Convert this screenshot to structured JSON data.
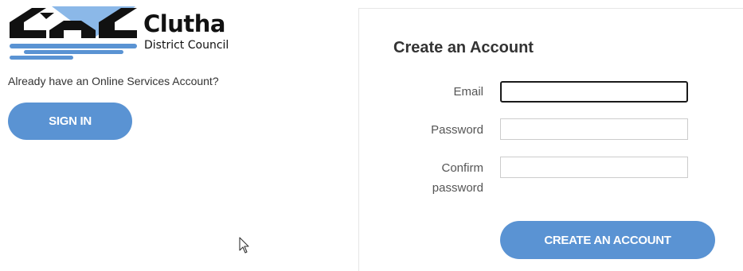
{
  "brand": {
    "name": "Clutha",
    "subtitle": "District Council",
    "colors": {
      "dark": "#111111",
      "accent": "#5a93d3",
      "light_blue": "#8bb8e8"
    }
  },
  "signin_section": {
    "prompt": "Already have an Online Services Account?",
    "button_label": "SIGN IN"
  },
  "create_account": {
    "title": "Create an Account",
    "fields": [
      {
        "label": "Email",
        "value": "",
        "focused": true
      },
      {
        "label": "Password",
        "value": "",
        "focused": false
      },
      {
        "label_line1": "Confirm",
        "label_line2": "password",
        "value": "",
        "focused": false
      }
    ],
    "submit_label": "CREATE AN ACCOUNT"
  },
  "icons": {
    "cursor": "mouse-pointer-icon"
  }
}
